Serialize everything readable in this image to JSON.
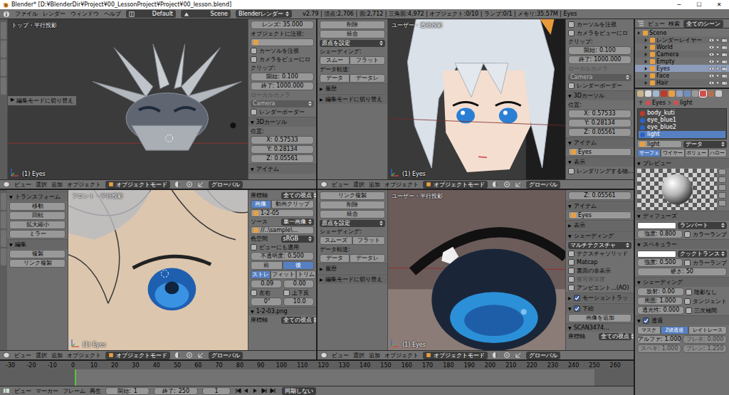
{
  "window": {
    "title": "Blender* [D:¥BlenderDir¥Project¥00_LessonProject¥Project¥00_lesson.blend]",
    "controls": [
      "─",
      "☐",
      "✕"
    ]
  },
  "info_bar": {
    "menus": [
      "ファイル",
      "レンダー",
      "ウィンドウ",
      "ヘルプ"
    ],
    "layout": "Default",
    "scene": "Scene",
    "engine": "Blenderレンダー",
    "stats": "v2.79 | 頂点:2,706 | 面:2,712 | 三角面:4,972 | オブジェクト:0/10 | ランプ:0/1 | メモリ:35.57M | Eyes"
  },
  "viewports": [
    {
      "title": "トップ・平行投影",
      "object": "(1) Eyes",
      "operator": {
        "arrow": "▶",
        "text": "編集モードに切り替え"
      },
      "toolshelf": [],
      "npanel": [
        {
          "kind": "field",
          "label": "レンズ:",
          "value": "35.000"
        },
        {
          "kind": "label",
          "text": "オブジェクトに注視:"
        },
        {
          "kind": "input",
          "text": ""
        },
        {
          "kind": "check",
          "text": "カーソルを注視",
          "checked": false
        },
        {
          "kind": "check",
          "text": "カメラをビューにロ",
          "checked": false
        },
        {
          "kind": "label",
          "text": "クリップ:"
        },
        {
          "kind": "field",
          "label": "開始:",
          "value": "0.100"
        },
        {
          "kind": "field",
          "label": "終了:",
          "value": "1000.000"
        },
        {
          "kind": "label",
          "text": "ローカルカメラ",
          "disabled": true
        },
        {
          "kind": "select",
          "text": "Camera",
          "disabled": true
        },
        {
          "kind": "check",
          "text": "レンダーボーダー",
          "checked": false
        },
        {
          "kind": "heading",
          "arrow": "▼",
          "text": "3Dカーソル"
        },
        {
          "kind": "label",
          "text": "位置:"
        },
        {
          "kind": "field",
          "label": "X:",
          "value": "0.57533"
        },
        {
          "kind": "field",
          "label": "Y:",
          "value": "0.28134"
        },
        {
          "kind": "field",
          "label": "Z:",
          "value": "0.05561"
        },
        {
          "kind": "heading",
          "arrow": "▼",
          "text": "アイテム"
        }
      ],
      "header": {
        "menus": [
          "ビュー",
          "選択",
          "追加",
          "オブジェクト"
        ],
        "mode": "オブジェクトモード",
        "orientation": "グローバル"
      }
    },
    {
      "title": "ユーザー・透視投影",
      "object": "(1) Eyes",
      "operator": null,
      "toolshelf": [
        {
          "kind": "button",
          "text": "削除"
        },
        {
          "kind": "button",
          "text": "統合"
        },
        {
          "kind": "select",
          "text": "原点を設定"
        },
        {
          "kind": "label",
          "text": "シェーディング:"
        },
        {
          "kind": "buttons",
          "items": [
            {
              "text": "スムー",
              "selected": false
            },
            {
              "text": "フラット",
              "selected": false
            }
          ]
        },
        {
          "kind": "label",
          "text": "データ転送:"
        },
        {
          "kind": "buttons",
          "items": [
            {
              "text": "データ",
              "selected": false
            },
            {
              "text": "データレ",
              "selected": false
            }
          ]
        },
        {
          "kind": "heading",
          "arrow": "▶",
          "text": "履歴"
        },
        {
          "kind": "heading",
          "arrow": "▶",
          "text": "編集モードに切り替え"
        }
      ],
      "npanel": [
        {
          "kind": "check",
          "text": "カーソルを注視",
          "checked": false
        },
        {
          "kind": "check",
          "text": "カメラをビューにロ",
          "checked": false
        },
        {
          "kind": "label",
          "text": "クリップ:"
        },
        {
          "kind": "field",
          "label": "開始:",
          "value": "0.100"
        },
        {
          "kind": "field",
          "label": "終了:",
          "value": "1000.000"
        },
        {
          "kind": "label",
          "text": "ローカルカメラ",
          "disabled": true
        },
        {
          "kind": "select",
          "text": "Camera",
          "disabled": true
        },
        {
          "kind": "check",
          "text": "レンダーボーダー",
          "checked": false
        },
        {
          "kind": "heading",
          "arrow": "▼",
          "text": "3Dカーソル"
        },
        {
          "kind": "label",
          "text": "位置:"
        },
        {
          "kind": "field",
          "label": "X:",
          "value": "0.57533"
        },
        {
          "kind": "field",
          "label": "Y:",
          "value": "0.28134"
        },
        {
          "kind": "field",
          "label": "Z:",
          "value": "0.05561"
        },
        {
          "kind": "heading",
          "arrow": "▼",
          "text": "アイテム"
        },
        {
          "kind": "input",
          "text": "Eyes"
        },
        {
          "kind": "heading",
          "arrow": "▼",
          "text": "表示"
        },
        {
          "kind": "check",
          "text": "レンダリングする物...",
          "checked": false
        }
      ],
      "header": {
        "menus": [
          "ビュー",
          "選択",
          "追加",
          "オブジェクト"
        ],
        "mode": "オブジェクトモード",
        "orientation": "グローバル"
      }
    },
    {
      "title": "フロント・平行投影",
      "object": "(1) Eyes",
      "operator": null,
      "toolshelf": [
        {
          "kind": "heading",
          "arrow": "▼",
          "text": "トランスフォーム"
        },
        {
          "kind": "button",
          "text": "移動"
        },
        {
          "kind": "button",
          "text": "回転"
        },
        {
          "kind": "button",
          "text": "拡大縮小"
        },
        {
          "kind": "button",
          "text": "ミラー"
        },
        {
          "kind": "heading",
          "arrow": "▼",
          "text": "編集"
        },
        {
          "kind": "button",
          "text": "複製"
        },
        {
          "kind": "button",
          "text": "リンク複製"
        }
      ],
      "npanel": [
        {
          "kind": "row",
          "cells": [
            {
              "kind": "label",
              "text": "座標軸"
            },
            {
              "kind": "select",
              "text": "全ての視点"
            }
          ]
        },
        {
          "kind": "buttons",
          "items": [
            {
              "text": "画像",
              "selected": true
            },
            {
              "text": "動画クリップ",
              "selected": false
            }
          ]
        },
        {
          "kind": "input",
          "text": "1-2-05"
        },
        {
          "kind": "row",
          "cells": [
            {
              "kind": "label",
              "text": "ソース"
            },
            {
              "kind": "select",
              "text": "単一画像"
            }
          ]
        },
        {
          "kind": "input",
          "text": "//..\\sample\\..."
        },
        {
          "kind": "row",
          "cells": [
            {
              "kind": "label",
              "text": "色空間"
            },
            {
              "kind": "select",
              "text": "sRGB"
            }
          ]
        },
        {
          "kind": "check",
          "text": "ビューにも適用",
          "checked": false
        },
        {
          "kind": "field",
          "label": "不透明度:",
          "value": "0.500"
        },
        {
          "kind": "buttons",
          "items": [
            {
              "text": "前",
              "selected": false
            },
            {
              "text": "後",
              "selected": true
            }
          ]
        },
        {
          "kind": "buttons",
          "items": [
            {
              "text": "ストレ",
              "selected": true
            },
            {
              "text": "フィット",
              "selected": false
            },
            {
              "text": "トリム",
              "selected": false
            }
          ]
        },
        {
          "kind": "row",
          "cells": [
            {
              "kind": "field",
              "label": "",
              "value": "0.09"
            },
            {
              "kind": "field",
              "label": "",
              "value": "0.00"
            }
          ]
        },
        {
          "kind": "row",
          "cells": [
            {
              "kind": "check",
              "text": "左右",
              "checked": false
            },
            {
              "kind": "check",
              "text": "上下反",
              "checked": false
            }
          ]
        },
        {
          "kind": "row",
          "cells": [
            {
              "kind": "field",
              "label": "",
              "value": "0°"
            },
            {
              "kind": "field",
              "label": "",
              "value": "10.0"
            }
          ]
        },
        {
          "kind": "heading",
          "arrow": "▼",
          "text": "1-2-03.png"
        },
        {
          "kind": "row",
          "cells": [
            {
              "kind": "label",
              "text": "座標軸"
            },
            {
              "kind": "select",
              "text": "全ての視点"
            }
          ]
        }
      ],
      "header": {
        "menus": [
          "ビュー",
          "選択",
          "追加",
          "オブジェクト"
        ],
        "mode": "オブジェクトモード",
        "orientation": "グローバル"
      }
    },
    {
      "title": "ユーザー・平行投影",
      "object": "(1) Eyes",
      "operator": null,
      "toolshelf": [
        {
          "kind": "button",
          "text": "リンク複製"
        },
        {
          "kind": "button",
          "text": "削除"
        },
        {
          "kind": "button",
          "text": "統合"
        },
        {
          "kind": "select",
          "text": "原点を設定"
        },
        {
          "kind": "label",
          "text": "シェーディング:"
        },
        {
          "kind": "buttons",
          "items": [
            {
              "text": "スムーズ",
              "selected": false
            },
            {
              "text": "フラット",
              "selected": false
            }
          ]
        },
        {
          "kind": "label",
          "text": "データ転送:"
        },
        {
          "kind": "buttons",
          "items": [
            {
              "text": "データ",
              "selected": false
            },
            {
              "text": "データレ",
              "selected": false
            }
          ]
        },
        {
          "kind": "heading",
          "arrow": "▶",
          "text": "履歴"
        },
        {
          "kind": "heading",
          "arrow": "▶",
          "text": "編集モードに切り替え"
        }
      ],
      "npanel": [
        {
          "kind": "field",
          "label": "Z:",
          "value": "0.05561"
        },
        {
          "kind": "heading",
          "arrow": "▼",
          "text": "アイテム"
        },
        {
          "kind": "input",
          "text": "Eyes"
        },
        {
          "kind": "heading",
          "arrow": "▶",
          "text": "表示"
        },
        {
          "kind": "heading",
          "arrow": "▼",
          "text": "シェーディング"
        },
        {
          "kind": "select",
          "text": "マルチテクスチャ"
        },
        {
          "kind": "check",
          "text": "テクスチャソリッド",
          "checked": false
        },
        {
          "kind": "check",
          "text": "Matcap",
          "checked": false
        },
        {
          "kind": "check",
          "text": "裏面の非表示",
          "checked": false
        },
        {
          "kind": "check",
          "text": "被写界深度",
          "checked": false,
          "disabled": true
        },
        {
          "kind": "check",
          "text": "アンビエント...(AO)",
          "checked": false
        },
        {
          "kind": "heading",
          "arrow": "▶",
          "text": "モーショントラッ",
          "checked": true
        },
        {
          "kind": "heading",
          "arrow": "▼",
          "text": "下絵",
          "checked": true
        },
        {
          "kind": "button",
          "text": "画像を追加"
        },
        {
          "kind": "heading",
          "arrow": "▼",
          "text": "SCAN3474..."
        },
        {
          "kind": "row",
          "cells": [
            {
              "kind": "label",
              "text": "座標軸"
            },
            {
              "kind": "select",
              "text": "全ての視点"
            }
          ]
        }
      ],
      "header": {
        "menus": [
          "ビュー",
          "選択",
          "追加",
          "オブジェクト"
        ],
        "mode": "オブジェクトモード",
        "orientation": "グローバル"
      }
    }
  ],
  "timeline": {
    "ruler": [
      "-30",
      "-20",
      "-10",
      "0",
      "10",
      "20",
      "30",
      "40",
      "50",
      "60",
      "70",
      "80",
      "90",
      "100",
      "110",
      "120",
      "130",
      "140",
      "150",
      "160",
      "170",
      "180",
      "190",
      "200",
      "210",
      "220",
      "230",
      "240",
      "250",
      "260"
    ],
    "menus": [
      "ビュー",
      "マーカー",
      "フレーム",
      "再生"
    ],
    "start_label": "開始:",
    "start": "1",
    "end_label": "終了:",
    "end": "250",
    "frame": "1",
    "sync": "同期しない"
  },
  "outliner": {
    "menus": [
      "ビュー",
      "検索"
    ],
    "filter": "全てのシーン",
    "rows": [
      {
        "text": "Scene",
        "depth": 0,
        "selected": false
      },
      {
        "text": "レンダーレイヤー",
        "depth": 1,
        "selected": false
      },
      {
        "text": "World",
        "depth": 1,
        "selected": false
      },
      {
        "text": "Camera",
        "depth": 1,
        "selected": false
      },
      {
        "text": "Empty",
        "depth": 1,
        "selected": false
      },
      {
        "text": "Eyes",
        "depth": 1,
        "selected": true
      },
      {
        "text": "Face",
        "depth": 1,
        "selected": false
      },
      {
        "text": "Hair",
        "depth": 1,
        "selected": false
      }
    ]
  },
  "properties": {
    "crumbs": [
      "Eyes",
      "light"
    ],
    "rows": [
      {
        "kind": "list",
        "items": [
          {
            "text": "body_kuti",
            "color": "#c0392b",
            "selected": false
          },
          {
            "text": "eye_blue1",
            "color": "#2a62c8",
            "selected": false
          },
          {
            "text": "eye_blue2",
            "color": "#2a62c8",
            "selected": false
          },
          {
            "text": "light",
            "color": "#2a62c8",
            "selected": true
          }
        ]
      },
      {
        "kind": "row",
        "cells": [
          {
            "kind": "input",
            "text": "light"
          },
          {
            "kind": "select",
            "text": "データ"
          }
        ]
      },
      {
        "kind": "buttons",
        "items": [
          {
            "text": "サーフェ",
            "selected": true
          },
          {
            "text": "ワイヤー",
            "selected": false
          },
          {
            "text": "ボリュー",
            "selected": false
          },
          {
            "text": "ハロー",
            "selected": false
          }
        ]
      },
      {
        "kind": "heading",
        "arrow": "▼",
        "text": "プレビュー"
      },
      {
        "kind": "preview"
      },
      {
        "kind": "heading",
        "arrow": "▼",
        "text": "ディフューズ"
      },
      {
        "kind": "row",
        "cells": [
          {
            "kind": "swatch",
            "color": "#ffffff"
          },
          {
            "kind": "select",
            "text": "ランバート"
          }
        ]
      },
      {
        "kind": "row",
        "cells": [
          {
            "kind": "field",
            "label": "強度:",
            "value": "0.800"
          },
          {
            "kind": "check",
            "text": "カラーランプ",
            "checked": false
          }
        ]
      },
      {
        "kind": "heading",
        "arrow": "▼",
        "text": "スペキュラー"
      },
      {
        "kind": "row",
        "cells": [
          {
            "kind": "swatch",
            "color": "#ffffff"
          },
          {
            "kind": "select",
            "text": "クックトランス"
          }
        ]
      },
      {
        "kind": "row",
        "cells": [
          {
            "kind": "field",
            "label": "強度:",
            "value": "0.500"
          },
          {
            "kind": "check",
            "text": "カラーランプ",
            "checked": false
          }
        ]
      },
      {
        "kind": "field",
        "label": "硬さ:",
        "value": "50"
      },
      {
        "kind": "heading",
        "arrow": "▼",
        "text": "シェーディング"
      },
      {
        "kind": "row",
        "cells": [
          {
            "kind": "field",
            "label": "放射:",
            "value": "0.00"
          },
          {
            "kind": "check",
            "text": "陰影なし",
            "checked": false
          }
        ]
      },
      {
        "kind": "row",
        "cells": [
          {
            "kind": "field",
            "label": "周囲:",
            "value": "1.000"
          },
          {
            "kind": "check",
            "text": "タンジェント",
            "checked": false
          }
        ]
      },
      {
        "kind": "row",
        "cells": [
          {
            "kind": "field",
            "label": "透光性:",
            "value": "0.000"
          },
          {
            "kind": "check",
            "text": "三次補間",
            "checked": false
          }
        ]
      },
      {
        "kind": "heading",
        "arrow": "▼",
        "text": "透過",
        "checked": true
      },
      {
        "kind": "buttons",
        "items": [
          {
            "text": "マスク",
            "selected": false
          },
          {
            "text": "Z値透過",
            "selected": true
          },
          {
            "text": "レイトレース",
            "selected": false
          }
        ]
      },
      {
        "kind": "row",
        "cells": [
          {
            "kind": "field",
            "label": "アルファ:",
            "value": "1.000"
          },
          {
            "kind": "field",
            "label": "フレネ:",
            "value": "0.000",
            "disabled": true
          }
        ]
      },
      {
        "kind": "row",
        "cells": [
          {
            "kind": "field",
            "label": "スペキ:",
            "value": "1.000",
            "disabled": true
          },
          {
            "kind": "field",
            "label": "ブレン:",
            "value": "1.250",
            "disabled": true
          }
        ]
      }
    ]
  }
}
